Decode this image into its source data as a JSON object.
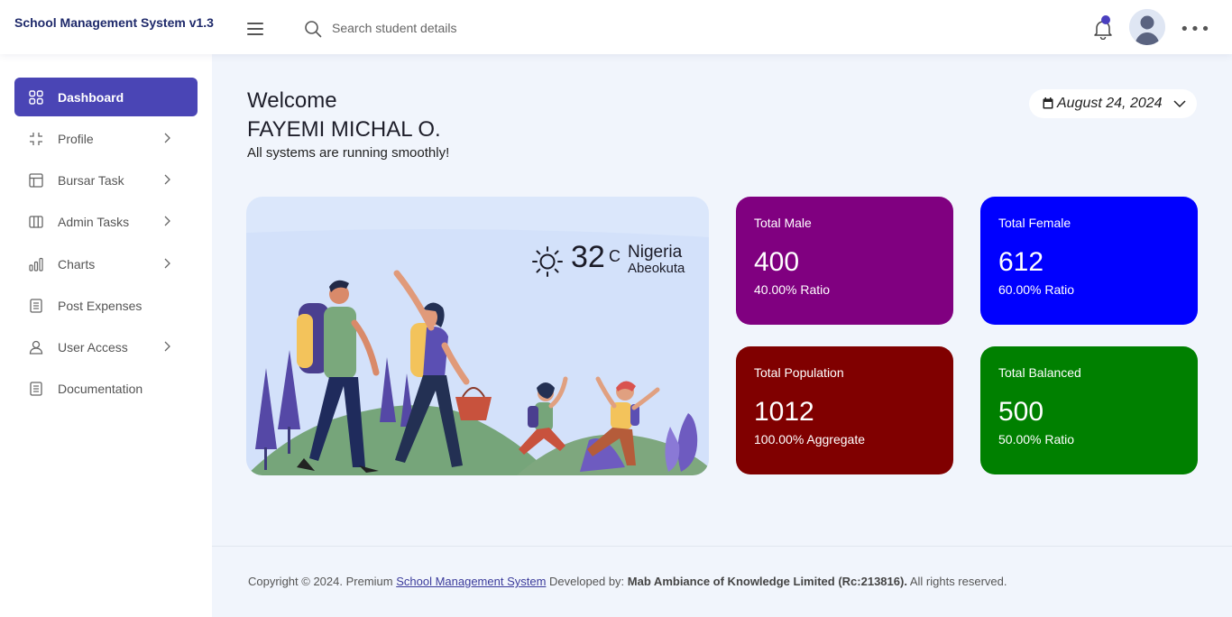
{
  "app": {
    "brand": "School Management System v1.3"
  },
  "search": {
    "placeholder": "Search student details"
  },
  "sidebar": {
    "items": [
      {
        "label": "Dashboard",
        "icon": "dashboard-grid-icon",
        "active": true,
        "has_submenu": false
      },
      {
        "label": "Profile",
        "icon": "shrink-icon",
        "active": false,
        "has_submenu": true
      },
      {
        "label": "Bursar Task",
        "icon": "layout-icon",
        "active": false,
        "has_submenu": true
      },
      {
        "label": "Admin Tasks",
        "icon": "columns-icon",
        "active": false,
        "has_submenu": true
      },
      {
        "label": "Charts",
        "icon": "bar-chart-icon",
        "active": false,
        "has_submenu": true
      },
      {
        "label": "Post Expenses",
        "icon": "document-icon",
        "active": false,
        "has_submenu": false
      },
      {
        "label": "User Access",
        "icon": "user-icon",
        "active": false,
        "has_submenu": true
      },
      {
        "label": "Documentation",
        "icon": "document-icon",
        "active": false,
        "has_submenu": false
      }
    ]
  },
  "welcome": {
    "greeting": "Welcome",
    "name": "FAYEMI MICHAL O.",
    "status": "All systems are running smoothly!"
  },
  "date": {
    "label": "August 24, 2024"
  },
  "weather": {
    "temperature": "32",
    "unit": "C",
    "country": "Nigeria",
    "city": "Abeokuta",
    "icon": "sun-icon"
  },
  "stats": [
    {
      "title": "Total Male",
      "value": "400",
      "sub": "40.00% Ratio",
      "color": "#800080"
    },
    {
      "title": "Total Female",
      "value": "612",
      "sub": "60.00% Ratio",
      "color": "#0000ff"
    },
    {
      "title": "Total Population",
      "value": "1012",
      "sub": "100.00% Aggregate",
      "color": "#800000"
    },
    {
      "title": "Total Balanced",
      "value": "500",
      "sub": "50.00% Ratio",
      "color": "#008000"
    }
  ],
  "footer": {
    "prefix": "Copyright © 2024. Premium",
    "link": "School Management System",
    "middle": "Developed by:",
    "company": "Mab Ambiance of Knowledge Limited (Rc:213816).",
    "suffix": "All rights reserved."
  },
  "colors": {
    "accent": "#4a45b5",
    "background": "#f1f5fc",
    "brand_text": "#1f2a6b"
  }
}
